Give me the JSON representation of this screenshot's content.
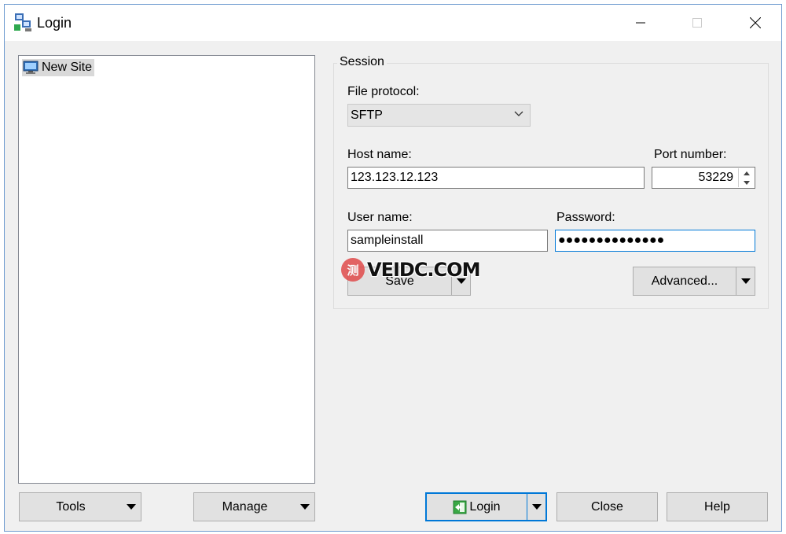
{
  "window": {
    "title": "Login"
  },
  "tree": {
    "items": [
      {
        "label": "New Site",
        "icon": "monitor-icon"
      }
    ]
  },
  "session": {
    "legend": "Session",
    "file_protocol": {
      "label": "File protocol:",
      "value": "SFTP"
    },
    "host": {
      "label": "Host name:",
      "value": "123.123.12.123"
    },
    "port": {
      "label": "Port number:",
      "value": "53229"
    },
    "user": {
      "label": "User name:",
      "value": "sampleinstall"
    },
    "password": {
      "label": "Password:",
      "masked": "●●●●●●●●●●●●●●"
    },
    "save_label": "Save",
    "advanced_label": "Advanced..."
  },
  "buttons": {
    "tools": "Tools",
    "manage": "Manage",
    "login": "Login",
    "close": "Close",
    "help": "Help"
  },
  "watermark": {
    "badge": "测",
    "text": "VEIDC.COM"
  },
  "colors": {
    "accent": "#0078d7",
    "button_bg": "#e1e1e1",
    "window_bg": "#f0f0f0"
  }
}
